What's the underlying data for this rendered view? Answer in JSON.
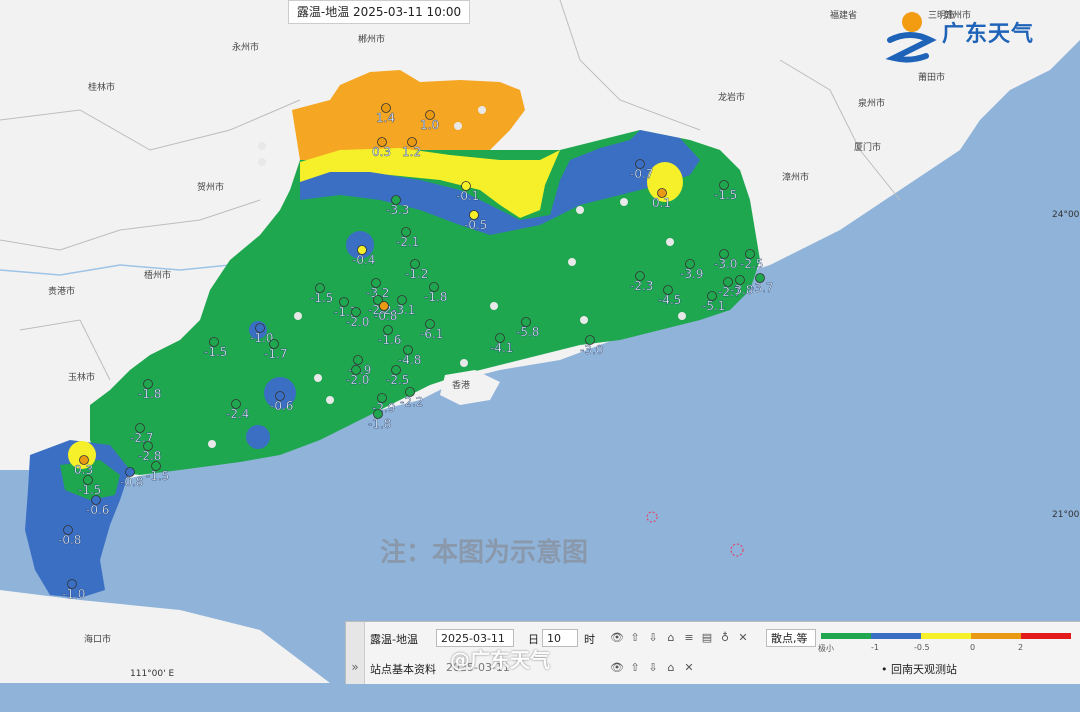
{
  "map_title": "露温-地温  2025-03-11 10:00",
  "logo": {
    "text": "广东天气"
  },
  "watermark_note": "注：本图为示意图",
  "weibo_watermark": "@广东天气",
  "coords": {
    "lon_label": "111°00' E",
    "lat_24": "24°00'",
    "lat_21": "21°00'"
  },
  "cities": [
    {
      "name": "福建省"
    },
    {
      "name": "赣州市"
    },
    {
      "name": "郴州市"
    },
    {
      "name": "永州市"
    },
    {
      "name": "桂林市"
    },
    {
      "name": "贺州市"
    },
    {
      "name": "梧州市"
    },
    {
      "name": "贵港市"
    },
    {
      "name": "玉林市"
    },
    {
      "name": "龙岩市"
    },
    {
      "name": "泉州市"
    },
    {
      "name": "漳州市"
    },
    {
      "name": "厦门市"
    },
    {
      "name": "莆田市"
    },
    {
      "name": "香港"
    },
    {
      "name": "海口市"
    },
    {
      "name": "三明市"
    }
  ],
  "stations": [
    {
      "v": "1.4",
      "c": "#e99a12"
    },
    {
      "v": "1.0",
      "c": "#e99a12"
    },
    {
      "v": "0.3",
      "c": "#e99a12"
    },
    {
      "v": "1.2",
      "c": "#e99a12"
    },
    {
      "v": "-0.1",
      "c": "#f5f02a"
    },
    {
      "v": "-0.5",
      "c": "#f5f02a"
    },
    {
      "v": "-0.7",
      "c": "#3a6fc4"
    },
    {
      "v": "0.1",
      "c": "#e99a12"
    },
    {
      "v": "-1.5",
      "c": "#1fa74f"
    },
    {
      "v": "-3.3",
      "c": "#1fa74f"
    },
    {
      "v": "-2.1",
      "c": "#1fa74f"
    },
    {
      "v": "-0.4",
      "c": "#f5f02a"
    },
    {
      "v": "-1.5",
      "c": "#1fa74f"
    },
    {
      "v": "-1.2",
      "c": "#1fa74f"
    },
    {
      "v": "-3.2",
      "c": "#1fa74f"
    },
    {
      "v": "-1.3",
      "c": "#1fa74f"
    },
    {
      "v": "-1.8",
      "c": "#1fa74f"
    },
    {
      "v": "-2.0",
      "c": "#1fa74f"
    },
    {
      "v": "-2.2",
      "c": "#1fa74f"
    },
    {
      "v": "-0.8",
      "c": "#e99a12"
    },
    {
      "v": "-3.1",
      "c": "#1fa74f"
    },
    {
      "v": "-1.0",
      "c": "#3a6fc4"
    },
    {
      "v": "-1.6",
      "c": "#1fa74f"
    },
    {
      "v": "-6.1",
      "c": "#1fa74f"
    },
    {
      "v": "-5.8",
      "c": "#1fa74f"
    },
    {
      "v": "-4.1",
      "c": "#1fa74f"
    },
    {
      "v": "-3.0",
      "c": "#1fa74f"
    },
    {
      "v": "-1.5",
      "c": "#1fa74f"
    },
    {
      "v": "-1.7",
      "c": "#1fa74f"
    },
    {
      "v": "-1.9",
      "c": "#1fa74f"
    },
    {
      "v": "-2.0",
      "c": "#1fa74f"
    },
    {
      "v": "-2.5",
      "c": "#1fa74f"
    },
    {
      "v": "-4.8",
      "c": "#1fa74f"
    },
    {
      "v": "-2.3",
      "c": "#1fa74f"
    },
    {
      "v": "-3.9",
      "c": "#1fa74f"
    },
    {
      "v": "-3.0",
      "c": "#1fa74f"
    },
    {
      "v": "-2.5",
      "c": "#1fa74f"
    },
    {
      "v": "-4.5",
      "c": "#1fa74f"
    },
    {
      "v": "-5.1",
      "c": "#1fa74f"
    },
    {
      "v": "-2.7",
      "c": "#1fa74f"
    },
    {
      "v": "-3.8",
      "c": "#1fa74f"
    },
    {
      "v": "-3.7",
      "c": "#1fa74f"
    },
    {
      "v": "-1.8",
      "c": "#1fa74f"
    },
    {
      "v": "-0.6",
      "c": "#3a6fc4"
    },
    {
      "v": "-2.4",
      "c": "#1fa74f"
    },
    {
      "v": "-2.9",
      "c": "#1fa74f"
    },
    {
      "v": "-2.2",
      "c": "#1fa74f"
    },
    {
      "v": "-1.8",
      "c": "#1fa74f"
    },
    {
      "v": "-2.7",
      "c": "#1fa74f"
    },
    {
      "v": "-2.8",
      "c": "#1fa74f"
    },
    {
      "v": "-0.8",
      "c": "#3a6fc4"
    },
    {
      "v": "0.3",
      "c": "#e99a12"
    },
    {
      "v": "-1.5",
      "c": "#1fa74f"
    },
    {
      "v": "-1.5",
      "c": "#1fa74f"
    },
    {
      "v": "-0.6",
      "c": "#3a6fc4"
    },
    {
      "v": "-0.8",
      "c": "#3a6fc4"
    },
    {
      "v": "-1.0",
      "c": "#3a6fc4"
    },
    {
      "v": "-0.5",
      "c": "#f5f02a"
    }
  ],
  "toolbar": {
    "row1_label": "露温-地温",
    "date_value": "2025-03-11",
    "day_label": "日",
    "hour_value": "10",
    "hour_label": "时",
    "display_mode": "散点,等",
    "row2_label": "站点基本资料",
    "row2_date": "2025-03-11",
    "station_legend": "回南天观测站",
    "collapse": "»"
  },
  "legend": {
    "colors": [
      "#1fa74f",
      "#3a6fc4",
      "#f5f02a",
      "#e99a12",
      "#e31a1c"
    ],
    "ticks": [
      "极小",
      "-1",
      "-0.5",
      "0",
      "2"
    ]
  }
}
